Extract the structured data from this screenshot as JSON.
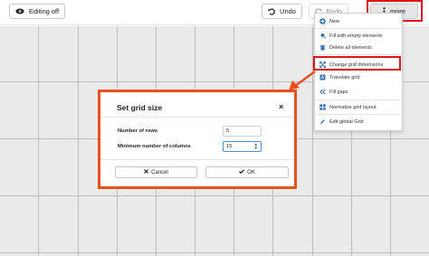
{
  "toolbar": {
    "editing_label": "Editing off",
    "undo_label": "Undo",
    "redo_label": "Redo",
    "more_label": "more"
  },
  "menu": {
    "items": [
      {
        "label": "New",
        "icon": "plus-circle-icon"
      },
      {
        "label": "Fill with empty elements",
        "icon": "paint-bucket-icon"
      },
      {
        "label": "Delete all elements",
        "icon": "trash-icon"
      },
      {
        "label": "Change grid dimensions",
        "icon": "expand-arrows-icon"
      },
      {
        "label": "Translate grid",
        "icon": "translate-icon"
      },
      {
        "label": "Fill gaps",
        "icon": "double-chevron-left-icon"
      },
      {
        "label": "Normalize grid layout",
        "icon": "grid-icon"
      },
      {
        "label": "Edit global Grid",
        "icon": "pencil-icon"
      }
    ],
    "highlighted_item": "Change grid dimensions"
  },
  "dialog": {
    "title": "Set grid size",
    "close_glyph": "×",
    "rows_label": "Number of rows",
    "rows_value": "5",
    "cols_label": "Minimum number of columns",
    "cols_value": "15",
    "cancel_label": "Cancel",
    "ok_label": "OK"
  },
  "colors": {
    "highlight": "#e01515",
    "dialog_border": "#e8501e",
    "menu_icon": "#3a6fb0",
    "grid_bg": "#eaeaea"
  }
}
